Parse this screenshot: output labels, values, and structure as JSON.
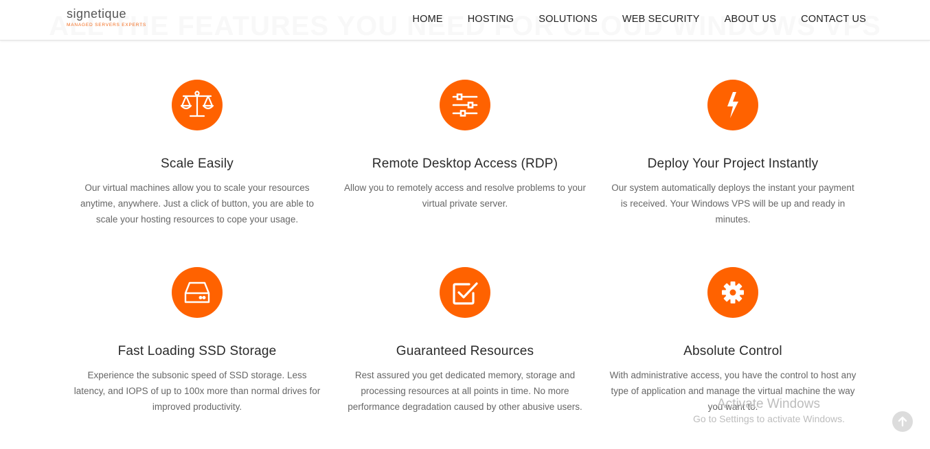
{
  "background_heading": "ALL THE FEATURES YOU NEED FOR CLOUD WINDOWS VPS",
  "logo": {
    "name": "signetique",
    "tagline": "MANAGED SERVERS EXPERTS"
  },
  "nav": {
    "items": [
      {
        "label": "HOME"
      },
      {
        "label": "HOSTING"
      },
      {
        "label": "SOLUTIONS"
      },
      {
        "label": "WEB SECURITY"
      },
      {
        "label": "ABOUT US"
      },
      {
        "label": "CONTACT US"
      }
    ]
  },
  "features": [
    {
      "icon": "scale-icon",
      "title": "Scale Easily",
      "text": "Our virtual machines allow you to scale your resources anytime, anywhere. Just a click of button, you are able to scale your hosting resources to cope your usage."
    },
    {
      "icon": "sliders-icon",
      "title": "Remote Desktop Access (RDP)",
      "text": "Allow you to remotely access and resolve problems to your virtual private server."
    },
    {
      "icon": "lightning-icon",
      "title": "Deploy Your Project Instantly",
      "text": "Our system automatically deploys the instant your payment is received. Your Windows VPS will be up and ready in minutes."
    },
    {
      "icon": "hard-drive-icon",
      "title": "Fast Loading SSD Storage",
      "text": "Experience the subsonic speed of SSD storage. Less latency, and IOPS of up to 100x more than normal drives for improved productivity."
    },
    {
      "icon": "checkbox-icon",
      "title": "Guaranteed Resources",
      "text": "Rest assured you get dedicated memory, storage and processing resources at all points in time. No more performance degradation caused by other abusive users."
    },
    {
      "icon": "gear-icon",
      "title": "Absolute Control",
      "text": "With administrative access, you have the control to host any type of application and manage the virtual machine the way you want to."
    }
  ],
  "watermark": {
    "title": "Activate Windows",
    "subtitle": "Go to Settings to activate Windows."
  },
  "colors": {
    "accent": "#ff6200",
    "logo_tagline": "#f26a1b"
  }
}
